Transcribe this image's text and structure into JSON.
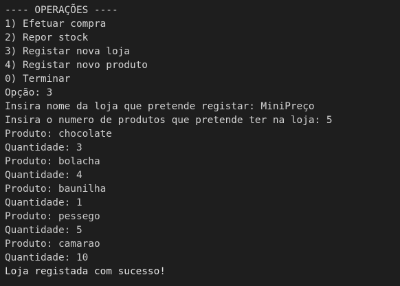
{
  "terminal": {
    "colors": {
      "background": "#1e1e1e",
      "text": "#cccccc"
    },
    "menu": {
      "header": "---- OPERAÇÕES ----",
      "options": [
        "1) Efetuar compra",
        "2) Repor stock",
        "3) Registar nova loja",
        "4) Registar novo produto",
        "0) Terminar"
      ]
    },
    "session": {
      "option_prompt": "Opção: 3",
      "store_name_prompt": "Insira nome da loja que pretende registar: MiniPreço",
      "product_count_prompt": "Insira o numero de produtos que pretende ter na loja: 5",
      "entries": [
        {
          "produto": "Produto: chocolate",
          "quantidade": "Quantidade: 3"
        },
        {
          "produto": "Produto: bolacha",
          "quantidade": "Quantidade: 4"
        },
        {
          "produto": "Produto: baunilha",
          "quantidade": "Quantidade: 1"
        },
        {
          "produto": "Produto: pessego",
          "quantidade": "Quantidade: 5"
        },
        {
          "produto": "Produto: camarao",
          "quantidade": "Quantidade: 10"
        }
      ],
      "success_message": "Loja registada com sucesso!"
    }
  }
}
